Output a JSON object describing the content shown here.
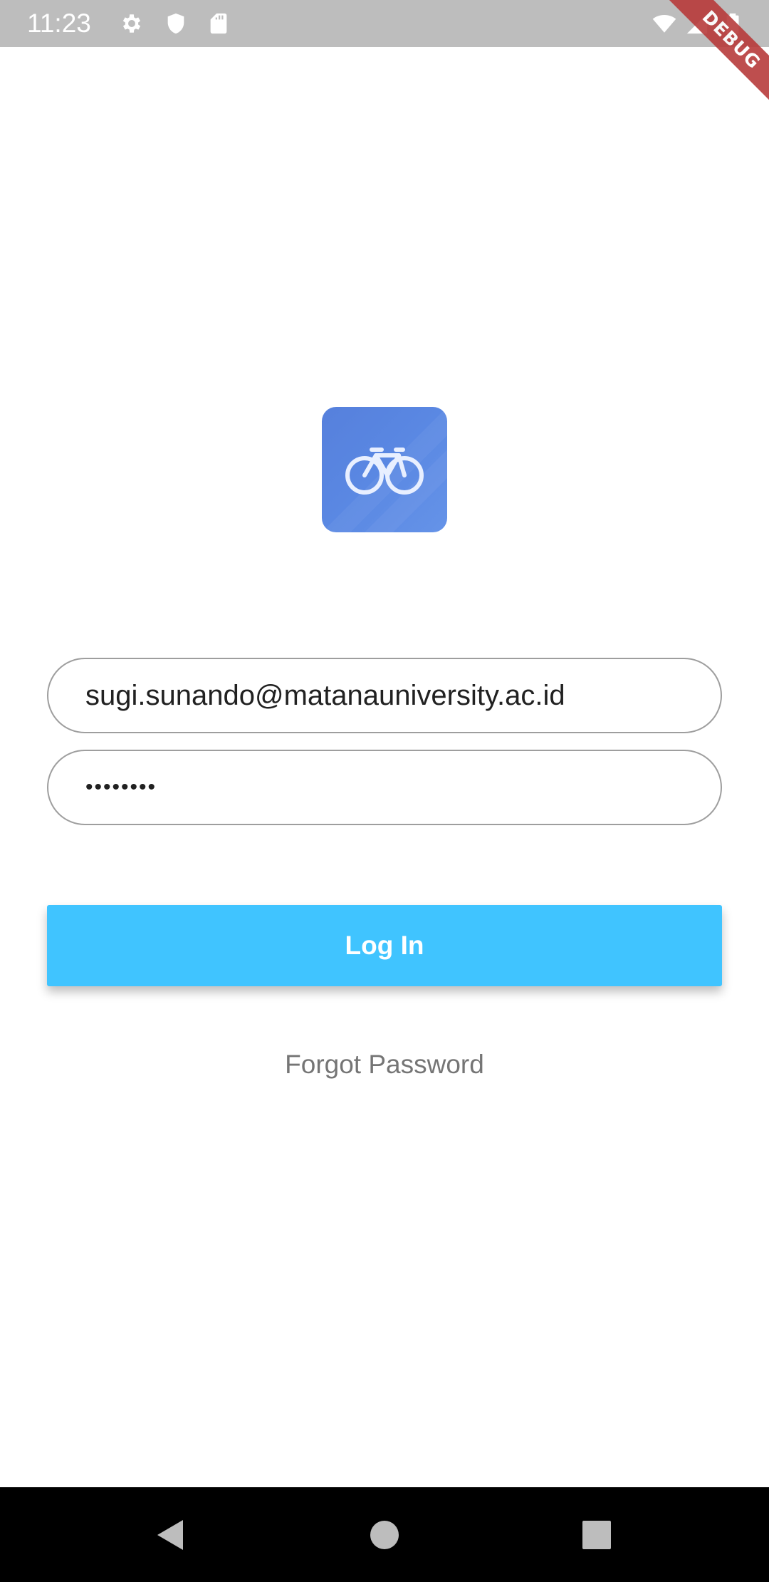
{
  "status_bar": {
    "time": "11:23",
    "left_icons": [
      "gear-icon",
      "shield-icon",
      "sd-card-icon"
    ],
    "right_icons": [
      "wifi-icon",
      "cellular-signal-icon",
      "battery-icon"
    ],
    "background": "#bdbdbd"
  },
  "debug_banner": {
    "label": "DEBUG",
    "color": "#b83b3b"
  },
  "logo": {
    "icon": "bicycle-icon",
    "color": "#5a88e3"
  },
  "login_form": {
    "email_value": "sugi.sunando@matanauniversity.ac.id",
    "password_value": "password",
    "login_label": "Log In",
    "login_color": "#40c4ff",
    "forgot_label": "Forgot Password"
  },
  "nav_bar": {
    "buttons": [
      "back-icon",
      "home-icon",
      "recents-icon"
    ]
  }
}
